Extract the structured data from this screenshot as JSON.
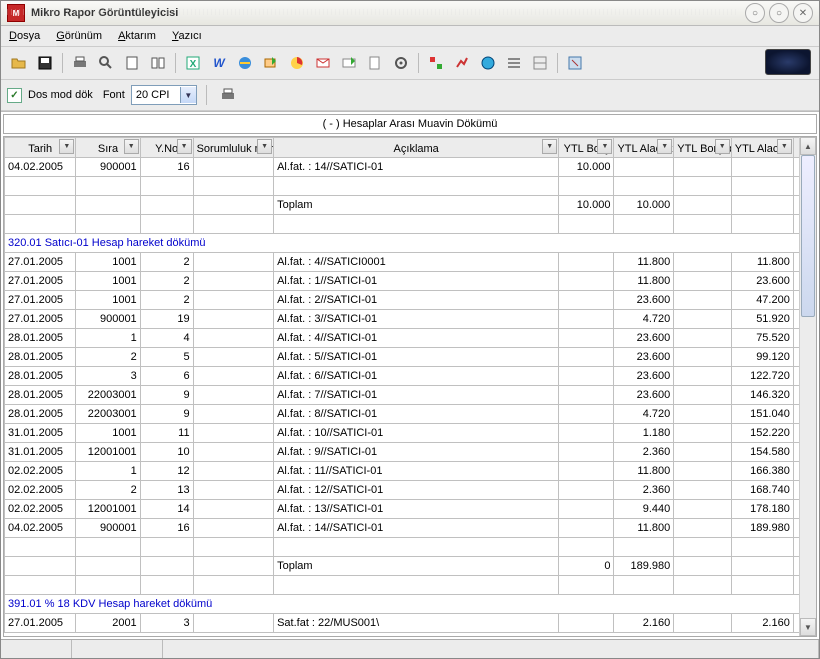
{
  "app": {
    "title": "Mikro Rapor Görüntüleyicisi",
    "icon_text": "M"
  },
  "menu": {
    "file": "Dosya",
    "view": "Görünüm",
    "transfer": "Aktarım",
    "printer": "Yazıcı"
  },
  "toolbar2": {
    "dos_mode_label": "Dos mod dök",
    "font_label": "Font",
    "cpi_value": "20 CPI"
  },
  "report": {
    "title": "(  -  ) Hesaplar Arası Muavin Dökümü"
  },
  "columns": {
    "tarih": "Tarih",
    "sira": "Sıra",
    "yno": "Y.No",
    "sorumluluk": "Sorumluluk merkezi",
    "aciklama": "Açıklama",
    "borc": "YTL Borç",
    "alacak": "YTL Alacak",
    "borc_bakiye": "YTL Borç bakiye",
    "alacak_bakiye": "YTL Alacak bakiye"
  },
  "sections": {
    "s320": "320.01 Satıcı-01 Hesap hareket dökümü",
    "s391": "391.01 % 18 KDV Hesap hareket dökümü"
  },
  "labels": {
    "toplam": "Toplam"
  },
  "rows_top": [
    {
      "tarih": "04.02.2005",
      "sira": "900001",
      "yno": "16",
      "sm": "",
      "acik": "Al.fat. : 14//SATICI-01",
      "borc": "10.000",
      "alacak": "",
      "bb": "",
      "ab": ""
    }
  ],
  "top_totals": {
    "borc": "10.000",
    "alacak": "10.000"
  },
  "rows_320": [
    {
      "tarih": "27.01.2005",
      "sira": "1001",
      "yno": "2",
      "sm": "",
      "acik": "Al.fat. : 4//SATICI0001",
      "borc": "",
      "alacak": "11.800",
      "bb": "",
      "ab": "11.800"
    },
    {
      "tarih": "27.01.2005",
      "sira": "1001",
      "yno": "2",
      "sm": "",
      "acik": "Al.fat. : 1//SATICI-01",
      "borc": "",
      "alacak": "11.800",
      "bb": "",
      "ab": "23.600"
    },
    {
      "tarih": "27.01.2005",
      "sira": "1001",
      "yno": "2",
      "sm": "",
      "acik": "Al.fat. : 2//SATICI-01",
      "borc": "",
      "alacak": "23.600",
      "bb": "",
      "ab": "47.200"
    },
    {
      "tarih": "27.01.2005",
      "sira": "900001",
      "yno": "19",
      "sm": "",
      "acik": "Al.fat. : 3//SATICI-01",
      "borc": "",
      "alacak": "4.720",
      "bb": "",
      "ab": "51.920"
    },
    {
      "tarih": "28.01.2005",
      "sira": "1",
      "yno": "4",
      "sm": "",
      "acik": "Al.fat. : 4//SATICI-01",
      "borc": "",
      "alacak": "23.600",
      "bb": "",
      "ab": "75.520"
    },
    {
      "tarih": "28.01.2005",
      "sira": "2",
      "yno": "5",
      "sm": "",
      "acik": "Al.fat. : 5//SATICI-01",
      "borc": "",
      "alacak": "23.600",
      "bb": "",
      "ab": "99.120"
    },
    {
      "tarih": "28.01.2005",
      "sira": "3",
      "yno": "6",
      "sm": "",
      "acik": "Al.fat. : 6//SATICI-01",
      "borc": "",
      "alacak": "23.600",
      "bb": "",
      "ab": "122.720"
    },
    {
      "tarih": "28.01.2005",
      "sira": "22003001",
      "yno": "9",
      "sm": "",
      "acik": "Al.fat. : 7//SATICI-01",
      "borc": "",
      "alacak": "23.600",
      "bb": "",
      "ab": "146.320"
    },
    {
      "tarih": "28.01.2005",
      "sira": "22003001",
      "yno": "9",
      "sm": "",
      "acik": "Al.fat. : 8//SATICI-01",
      "borc": "",
      "alacak": "4.720",
      "bb": "",
      "ab": "151.040"
    },
    {
      "tarih": "31.01.2005",
      "sira": "1001",
      "yno": "11",
      "sm": "",
      "acik": "Al.fat. : 10//SATICI-01",
      "borc": "",
      "alacak": "1.180",
      "bb": "",
      "ab": "152.220"
    },
    {
      "tarih": "31.01.2005",
      "sira": "12001001",
      "yno": "10",
      "sm": "",
      "acik": "Al.fat. : 9//SATICI-01",
      "borc": "",
      "alacak": "2.360",
      "bb": "",
      "ab": "154.580"
    },
    {
      "tarih": "02.02.2005",
      "sira": "1",
      "yno": "12",
      "sm": "",
      "acik": "Al.fat. : 11//SATICI-01",
      "borc": "",
      "alacak": "11.800",
      "bb": "",
      "ab": "166.380"
    },
    {
      "tarih": "02.02.2005",
      "sira": "2",
      "yno": "13",
      "sm": "",
      "acik": "Al.fat. : 12//SATICI-01",
      "borc": "",
      "alacak": "2.360",
      "bb": "",
      "ab": "168.740"
    },
    {
      "tarih": "02.02.2005",
      "sira": "12001001",
      "yno": "14",
      "sm": "",
      "acik": "Al.fat. : 13//SATICI-01",
      "borc": "",
      "alacak": "9.440",
      "bb": "",
      "ab": "178.180"
    },
    {
      "tarih": "04.02.2005",
      "sira": "900001",
      "yno": "16",
      "sm": "",
      "acik": "Al.fat. : 14//SATICI-01",
      "borc": "",
      "alacak": "11.800",
      "bb": "",
      "ab": "189.980"
    }
  ],
  "totals_320": {
    "borc": "0",
    "alacak": "189.980"
  },
  "rows_391": [
    {
      "tarih": "27.01.2005",
      "sira": "2001",
      "yno": "3",
      "sm": "",
      "acik": "Sat.fat : 22/MUS001\\",
      "borc": "",
      "alacak": "2.160",
      "bb": "",
      "ab": "2.160"
    }
  ]
}
